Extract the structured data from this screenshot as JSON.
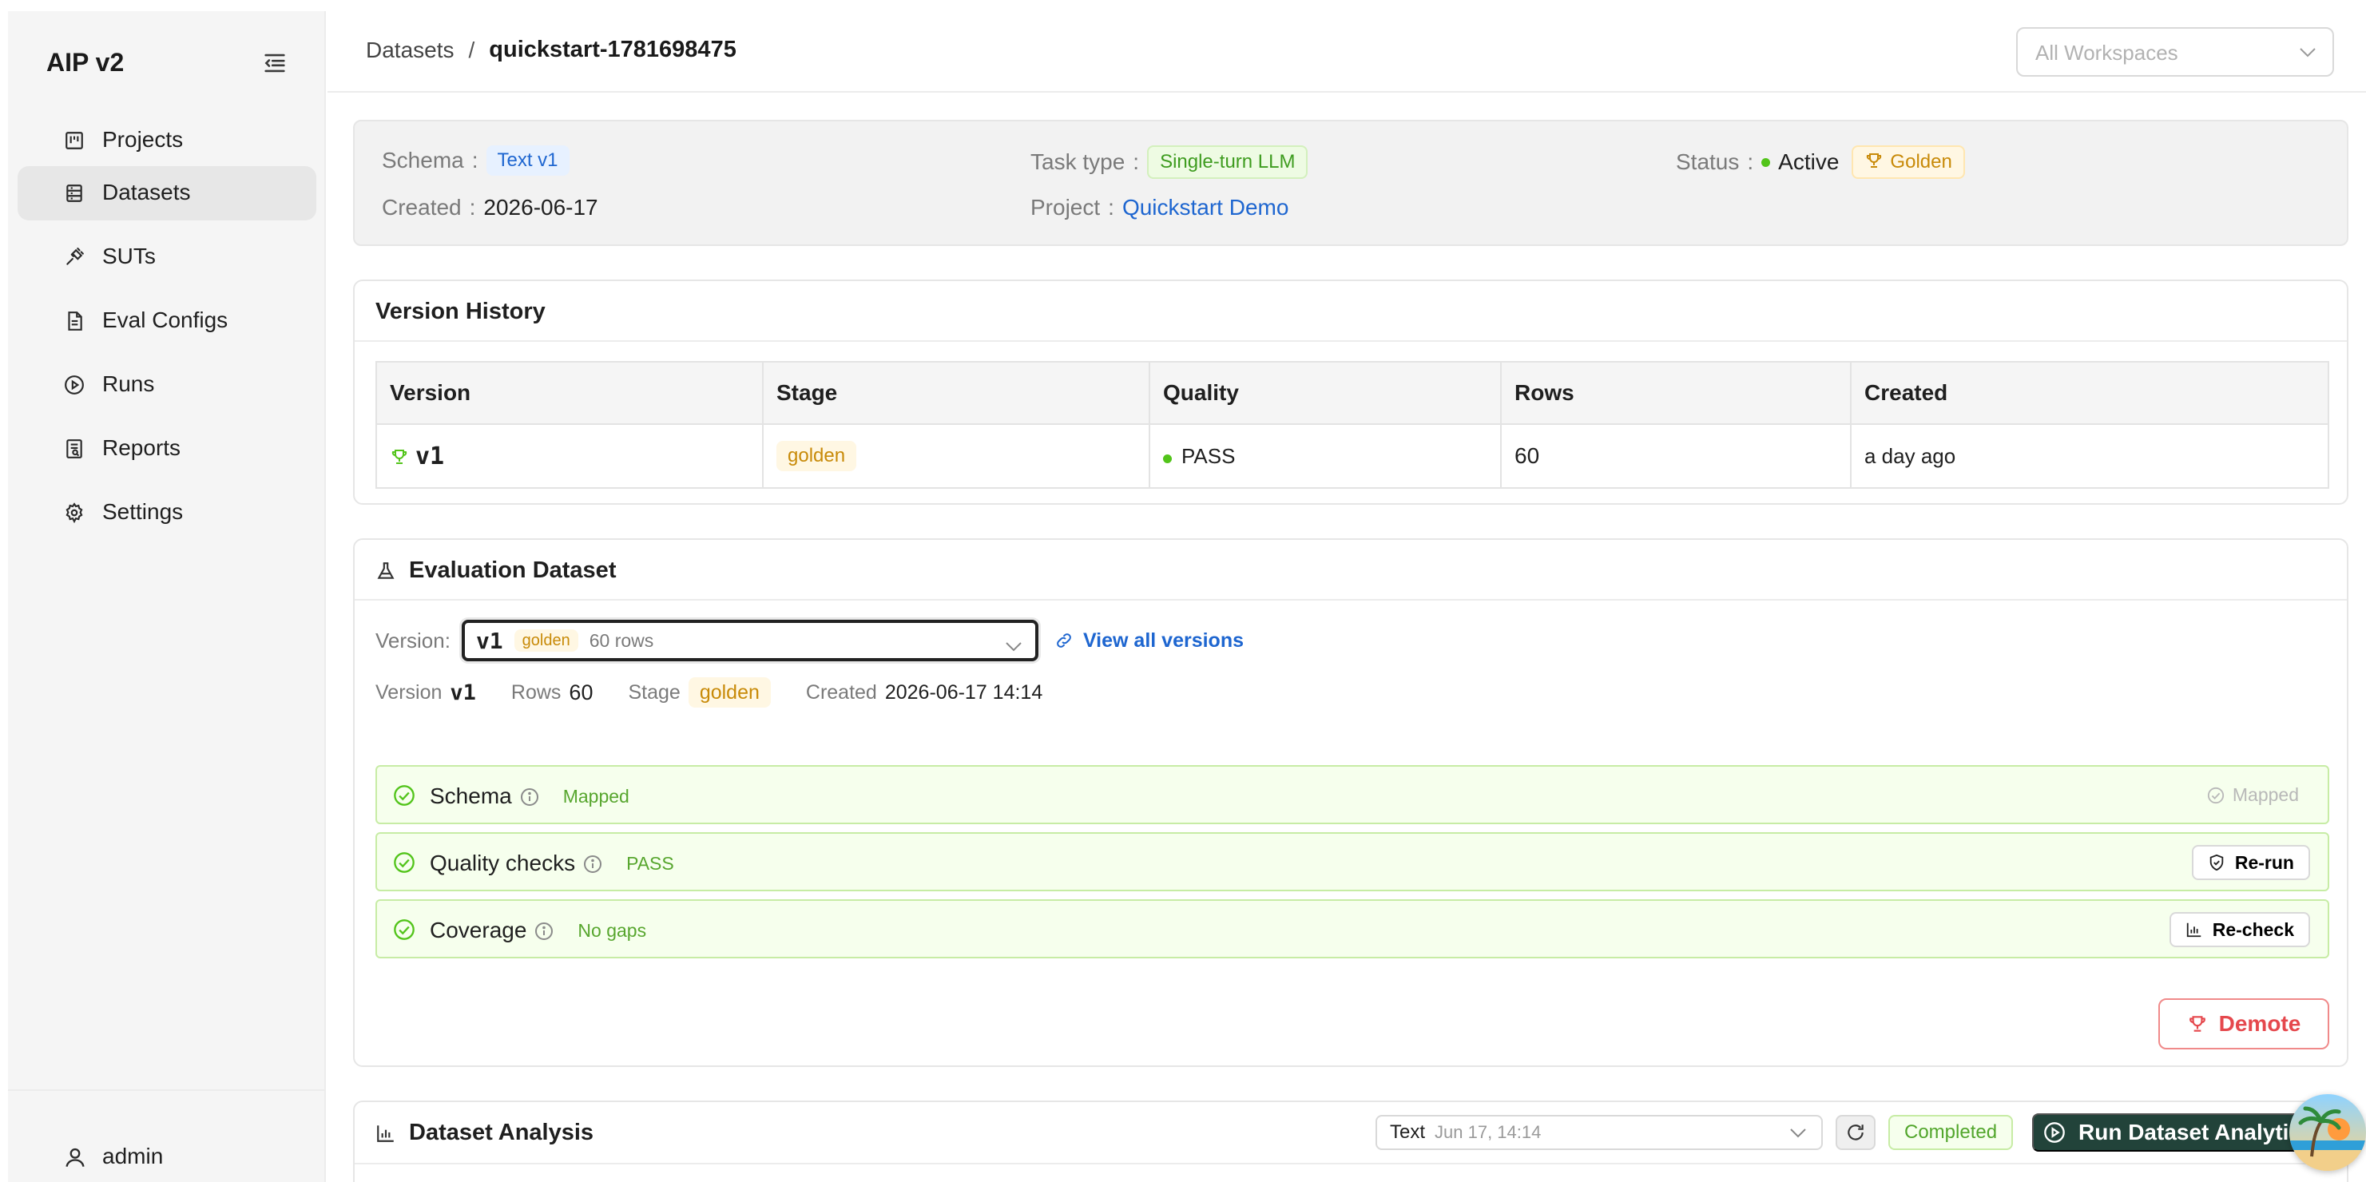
{
  "sidebar": {
    "brand": "AIP v2",
    "items": [
      {
        "label": "Projects",
        "icon": "kanban-icon"
      },
      {
        "label": "Datasets",
        "icon": "database-icon"
      },
      {
        "label": "SUTs",
        "icon": "plug-icon"
      },
      {
        "label": "Eval Configs",
        "icon": "file-icon"
      },
      {
        "label": "Runs",
        "icon": "play-circle-icon"
      },
      {
        "label": "Reports",
        "icon": "report-icon"
      },
      {
        "label": "Settings",
        "icon": "gear-icon"
      }
    ],
    "active": "Datasets",
    "user": "admin"
  },
  "header": {
    "breadcrumb_root": "Datasets",
    "breadcrumb_sep": "/",
    "breadcrumb_current": "quickstart-1781698475",
    "workspace_placeholder": "All Workspaces"
  },
  "meta": {
    "schema_label": "Schema",
    "schema_value": "Text v1",
    "created_label": "Created",
    "created_value": "2026-06-17",
    "task_label": "Task type",
    "task_value": "Single-turn LLM",
    "project_label": "Project",
    "project_value": "Quickstart Demo",
    "status_label": "Status",
    "status_value": "Active",
    "golden_label": "Golden",
    "colon": ":"
  },
  "version_history": {
    "title": "Version History",
    "columns": [
      "Version",
      "Stage",
      "Quality",
      "Rows",
      "Created"
    ],
    "rows": [
      {
        "version": "v1",
        "stage": "golden",
        "quality": "PASS",
        "rows": "60",
        "created": "a day ago"
      }
    ]
  },
  "evaluation": {
    "title": "Evaluation Dataset",
    "version_label": "Version:",
    "select_version": "v1",
    "select_stage": "golden",
    "select_rows": "60 rows",
    "view_all": "View all versions",
    "info_version_label": "Version",
    "info_version": "v1",
    "info_rows_label": "Rows",
    "info_rows": "60",
    "info_stage_label": "Stage",
    "info_stage": "golden",
    "info_created_label": "Created",
    "info_created": "2026-06-17 14:14",
    "checks": [
      {
        "title": "Schema",
        "status": "Mapped",
        "right": "Mapped"
      },
      {
        "title": "Quality checks",
        "status": "PASS",
        "button": "Re-run"
      },
      {
        "title": "Coverage",
        "status": "No gaps",
        "button": "Re-check"
      }
    ],
    "demote": "Demote"
  },
  "analysis": {
    "title": "Dataset Analysis",
    "select_text": "Text",
    "select_date": "Jun 17, 14:14",
    "status": "Completed",
    "run_button": "Run Dataset Analytics"
  },
  "colors": {
    "accent_blue": "#1e66d0",
    "success_green": "#52c41a",
    "golden": "#c88a08",
    "danger": "#e5484d",
    "primary_dark": "#22433a"
  }
}
